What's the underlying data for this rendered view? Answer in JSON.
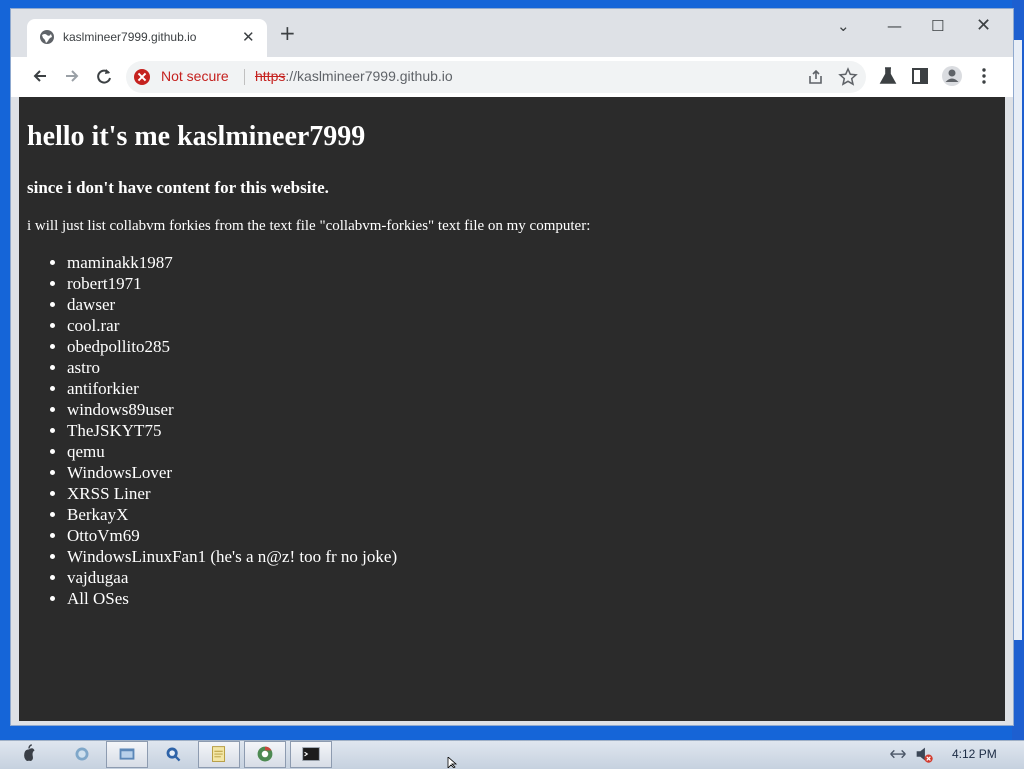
{
  "browser": {
    "tab_title": "kaslmineer7999.github.io",
    "security_label": "Not secure",
    "url_scheme": "https",
    "url_rest": "://kaslmineer7999.github.io"
  },
  "page": {
    "heading": "hello it's me kaslmineer7999",
    "subheading": "since i don't have content for this website.",
    "intro": "i will just list collabvm forkies from the text file \"collabvm-forkies\" text file on my computer:",
    "forkies": [
      "maminakk1987",
      "robert1971",
      "dawser",
      "cool.rar",
      "obedpollito285",
      "astro",
      "antiforkier",
      "windows89user",
      "TheJSKYT75",
      "qemu",
      "WindowsLover",
      "XRSS Liner",
      "BerkayX",
      "OttoVm69",
      "WindowsLinuxFan1 (he's a n@z! too fr no joke)",
      "vajdugaa",
      "All OSes"
    ]
  },
  "taskbar": {
    "clock": "4:12 PM"
  },
  "colors": {
    "page_bg": "#2b2b2b",
    "not_secure": "#c5221f",
    "desktop": "#1565d8"
  }
}
